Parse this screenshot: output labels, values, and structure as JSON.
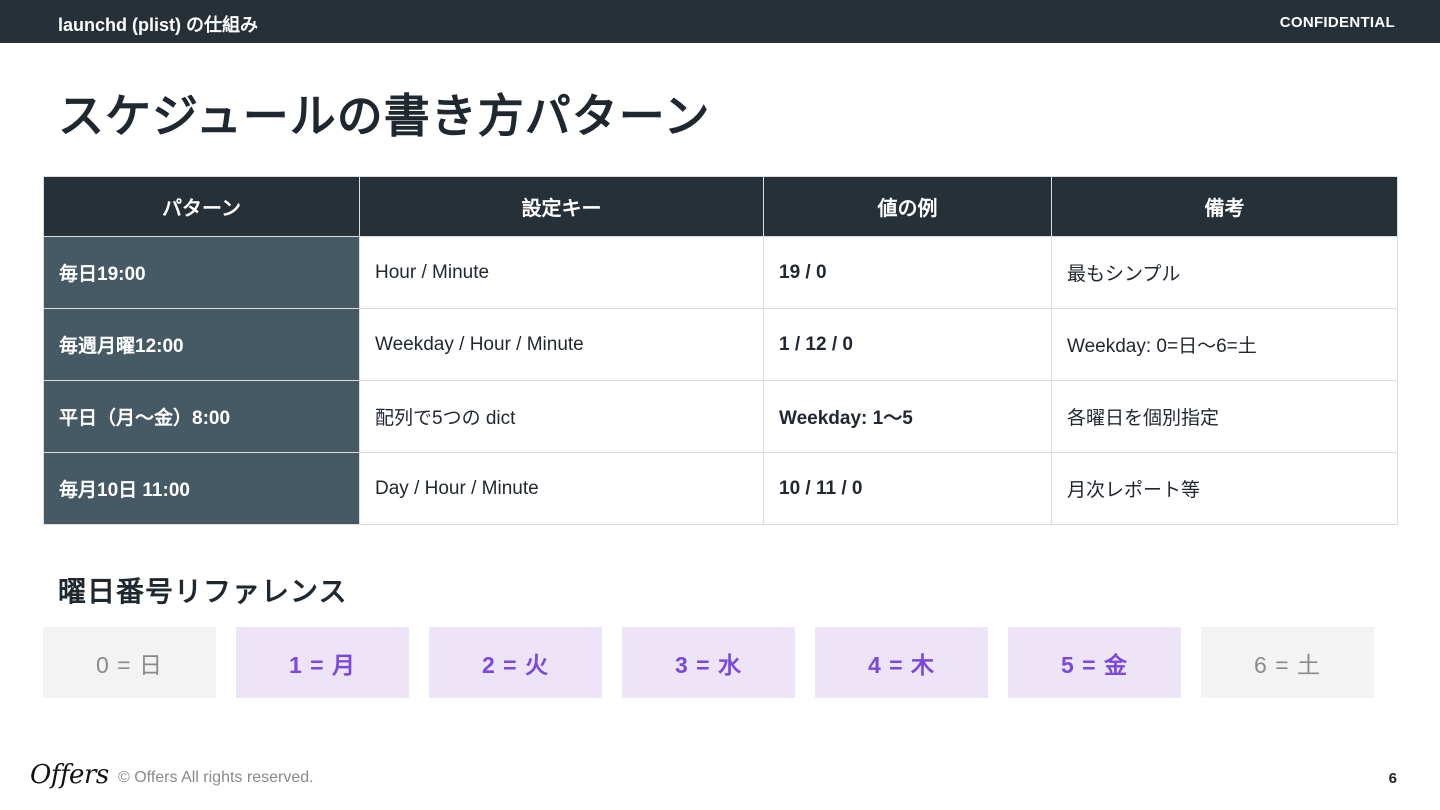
{
  "header": {
    "section": "launchd (plist) の仕組み",
    "confidential": "CONFIDENTIAL"
  },
  "title": "スケジュールの書き方パターン",
  "table": {
    "headers": [
      "パターン",
      "設定キー",
      "値の例",
      "備考"
    ],
    "rows": [
      [
        "毎日19:00",
        "Hour / Minute",
        "19 / 0",
        "最もシンプル"
      ],
      [
        "毎週月曜12:00",
        "Weekday / Hour / Minute",
        "1 / 12 / 0",
        "Weekday: 0=日〜6=土"
      ],
      [
        "平日（月〜金）8:00",
        "配列で5つの dict",
        "Weekday: 1〜5",
        "各曜日を個別指定"
      ],
      [
        "毎月10日 11:00",
        "Day / Hour / Minute",
        "10 / 11 / 0",
        "月次レポート等"
      ]
    ]
  },
  "weekday_reference": {
    "title": "曜日番号リファレンス",
    "days": [
      "0 = 日",
      "1 = 月",
      "2 = 火",
      "3 = 水",
      "4 = 木",
      "5 = 金",
      "6 = 土"
    ]
  },
  "colors": {
    "dark": "#263038",
    "row_header": "#465a66",
    "weekday_bg": "#ede4f7",
    "weekday_text": "#7b48dc",
    "weekend_bg": "#f3f3f3"
  },
  "footer": {
    "logo": "Offers",
    "copyright": "© Offers All rights reserved.",
    "page": "6"
  }
}
